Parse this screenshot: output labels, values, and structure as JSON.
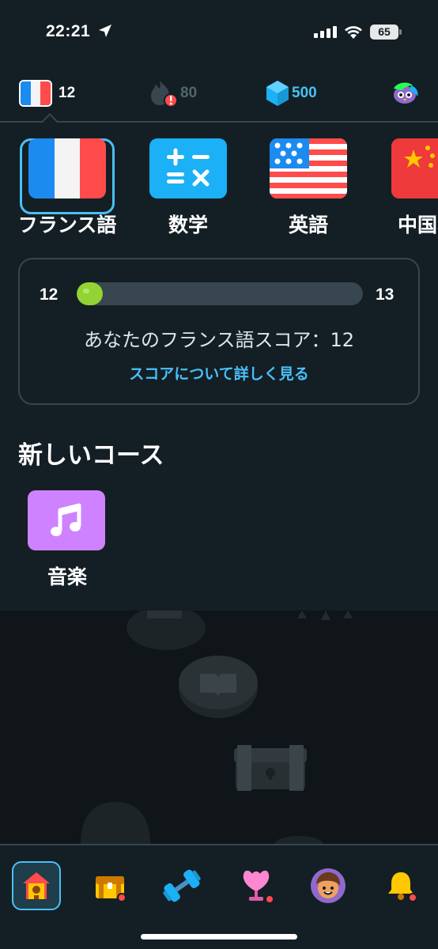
{
  "status_bar": {
    "time": "22:21",
    "battery": "65"
  },
  "header": {
    "course_score": "12",
    "streak": "80",
    "gems": "500"
  },
  "courses": [
    {
      "label": "フランス語",
      "icon": "france-flag-icon",
      "selected": true
    },
    {
      "label": "数学",
      "icon": "math-icon",
      "selected": false
    },
    {
      "label": "英語",
      "icon": "us-flag-icon",
      "selected": false
    },
    {
      "label": "中国",
      "icon": "china-flag-icon",
      "selected": false
    }
  ],
  "score_card": {
    "current": "12",
    "next": "13",
    "progress_fraction": 0.09,
    "score_text": "あなたのフランス語スコア：12",
    "link_text": "スコアについて詳しく見る"
  },
  "new_courses": {
    "title": "新しいコース",
    "items": [
      {
        "label": "音楽",
        "icon": "music-note-icon"
      }
    ]
  },
  "tabbar": {
    "tabs": [
      {
        "name": "home",
        "icon": "home-icon",
        "active": true
      },
      {
        "name": "chest",
        "icon": "treasure-chest-icon",
        "badge": true
      },
      {
        "name": "practice",
        "icon": "dumbbell-icon",
        "badge": false
      },
      {
        "name": "leaderboard",
        "icon": "trophy-icon",
        "badge": true
      },
      {
        "name": "profile",
        "icon": "profile-avatar-icon",
        "badge": false
      },
      {
        "name": "notifications",
        "icon": "bell-icon",
        "badge": true
      }
    ]
  },
  "colors": {
    "accent_blue": "#49c0f8",
    "progress_green": "#93d333",
    "panel": "#131f24",
    "border": "#37464f",
    "music_purple": "#ce82ff"
  }
}
